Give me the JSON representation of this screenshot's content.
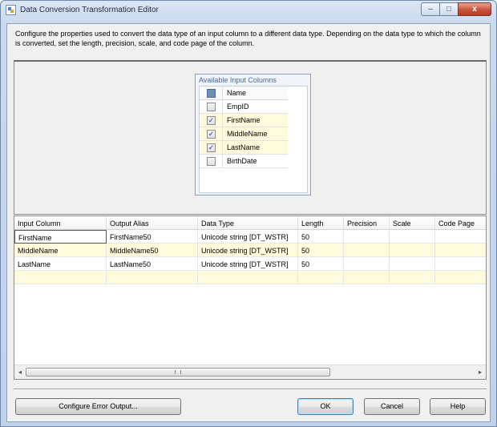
{
  "window": {
    "title": "Data Conversion Transformation Editor",
    "caption": {
      "minimize": "–",
      "maximize": "□",
      "close": "x"
    }
  },
  "description": "Configure the properties used to convert the data type of an input column to a different data type. Depending on the data type to which the column is converted, set the length, precision, scale, and code page of the column.",
  "available": {
    "title": "Available Input Columns",
    "header": "Name",
    "columns": [
      {
        "name": "EmpID",
        "checked": false
      },
      {
        "name": "FirstName",
        "checked": true
      },
      {
        "name": "MiddleName",
        "checked": true
      },
      {
        "name": "LastName",
        "checked": true
      },
      {
        "name": "BirthDate",
        "checked": false
      }
    ]
  },
  "grid": {
    "headers": [
      "Input Column",
      "Output Alias",
      "Data Type",
      "Length",
      "Precision",
      "Scale",
      "Code Page"
    ],
    "rows": [
      [
        "FirstName",
        "FirstName50",
        "Unicode string [DT_WSTR]",
        "50",
        "",
        "",
        ""
      ],
      [
        "MiddleName",
        "MiddleName50",
        "Unicode string [DT_WSTR]",
        "50",
        "",
        "",
        ""
      ],
      [
        "LastName",
        "LastName50",
        "Unicode string [DT_WSTR]",
        "50",
        "",
        "",
        ""
      ]
    ]
  },
  "scrollbar": {
    "left": "◂",
    "right": "▸"
  },
  "buttons": {
    "configure_error": "Configure Error Output...",
    "ok": "OK",
    "cancel": "Cancel",
    "help": "Help"
  },
  "check_glyph": "✓"
}
